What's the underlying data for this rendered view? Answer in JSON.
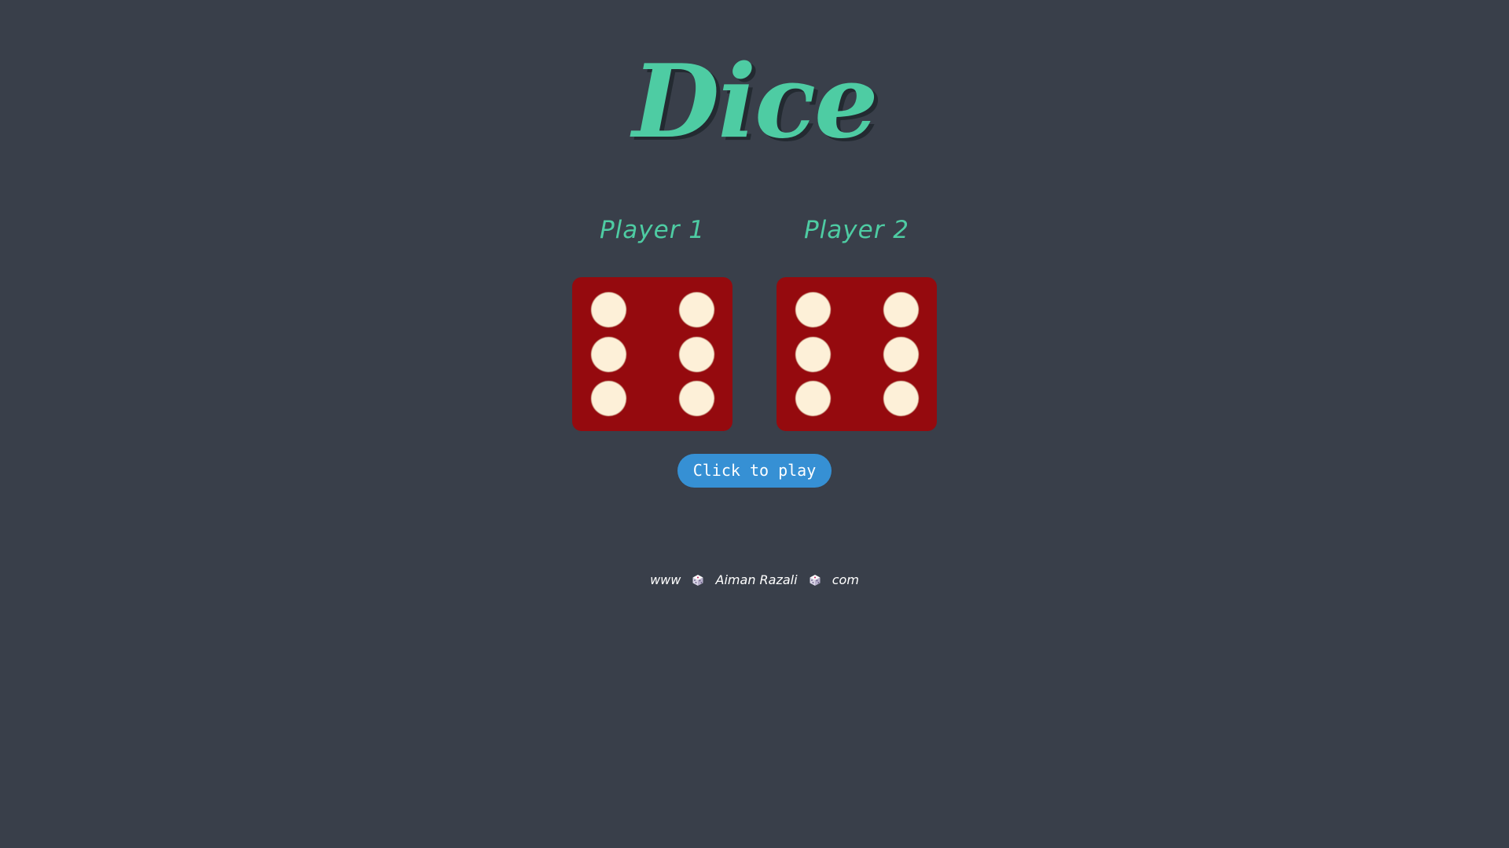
{
  "title": "Dice",
  "players": [
    {
      "label": "Player 1",
      "die_value": 6
    },
    {
      "label": "Player 2",
      "die_value": 6
    }
  ],
  "play_button": {
    "label": "Click to play"
  },
  "footer": {
    "parts": [
      "www",
      "Aiman Razali",
      "com"
    ],
    "separator_icon": "dice-icon"
  },
  "colors": {
    "background": "#393f4a",
    "accent": "#4ecca3",
    "die": "#950a0e",
    "pip": "#fdf0d8",
    "button": "#3690d4"
  }
}
